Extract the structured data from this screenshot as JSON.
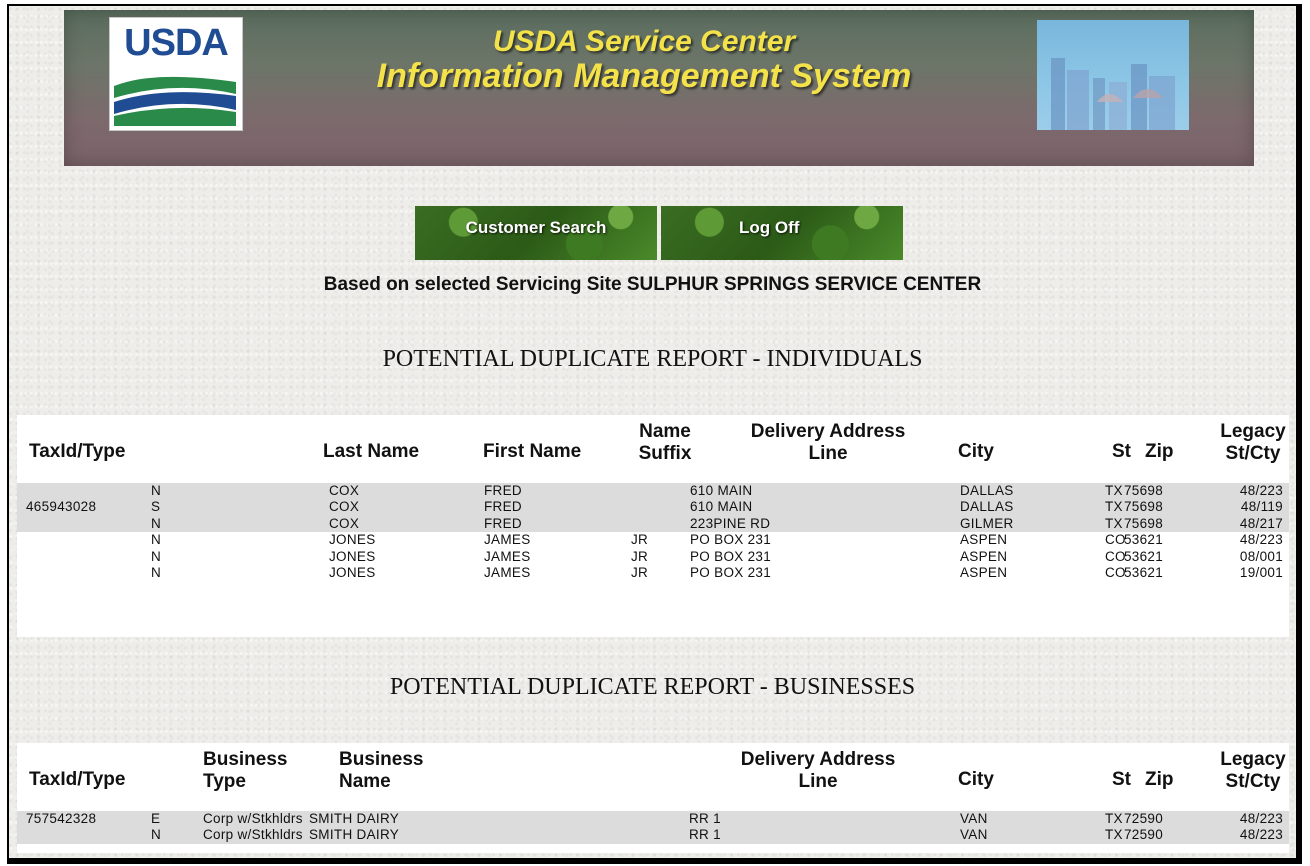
{
  "banner": {
    "logo_text": "USDA",
    "title_line1": "USDA Service Center",
    "title_line2": "Information Management System"
  },
  "nav": {
    "customer_search": "Customer Search",
    "log_off": "Log Off"
  },
  "site_text": "Based on selected Servicing Site SULPHUR SPRINGS SERVICE CENTER",
  "individuals": {
    "title": "POTENTIAL DUPLICATE REPORT - INDIVIDUALS",
    "headers": {
      "taxid": "TaxId/Type",
      "last": "Last Name",
      "first": "First Name",
      "suffix_1": "Name",
      "suffix_2": "Suffix",
      "addr_1": "Delivery Address",
      "addr_2": "Line",
      "city": "City",
      "st": "St",
      "zip": "Zip",
      "legacy_1": "Legacy",
      "legacy_2": "St/Cty"
    },
    "rows": [
      {
        "taxid": "",
        "type": "N",
        "last": "COX",
        "first": "FRED",
        "suffix": "",
        "addr": "610 MAIN",
        "city": "DALLAS",
        "st": "TX",
        "zip": "75698",
        "legacy": "48/223"
      },
      {
        "taxid": "465943028",
        "type": "S",
        "last": "COX",
        "first": "FRED",
        "suffix": "",
        "addr": "610 MAIN",
        "city": "DALLAS",
        "st": "TX",
        "zip": "75698",
        "legacy": "48/119"
      },
      {
        "taxid": "",
        "type": "N",
        "last": "COX",
        "first": "FRED",
        "suffix": "",
        "addr": "223PINE RD",
        "city": "GILMER",
        "st": "TX",
        "zip": "75698",
        "legacy": "48/217"
      },
      {
        "taxid": "",
        "type": "N",
        "last": "JONES",
        "first": "JAMES",
        "suffix": "JR",
        "addr": "PO BOX 231",
        "city": "ASPEN",
        "st": "CO",
        "zip": "53621",
        "legacy": "48/223"
      },
      {
        "taxid": "",
        "type": "N",
        "last": "JONES",
        "first": "JAMES",
        "suffix": "JR",
        "addr": "PO BOX 231",
        "city": "ASPEN",
        "st": "CO",
        "zip": "53621",
        "legacy": "08/001"
      },
      {
        "taxid": "",
        "type": "N",
        "last": "JONES",
        "first": "JAMES",
        "suffix": "JR",
        "addr": "PO BOX 231",
        "city": "ASPEN",
        "st": "CO",
        "zip": "53621",
        "legacy": "19/001"
      }
    ]
  },
  "businesses": {
    "title": "POTENTIAL DUPLICATE REPORT - BUSINESSES",
    "headers": {
      "taxid": "TaxId/Type",
      "btype_1": "Business",
      "btype_2": "Type",
      "bname_1": "Business",
      "bname_2": "Name",
      "addr_1": "Delivery Address",
      "addr_2": "Line",
      "city": "City",
      "st": "St",
      "zip": "Zip",
      "legacy_1": "Legacy",
      "legacy_2": "St/Cty"
    },
    "rows": [
      {
        "taxid": "757542328",
        "type": "E",
        "btype": "Corp w/Stkhldrs",
        "bname": "SMITH DAIRY",
        "addr": "RR 1",
        "city": "VAN",
        "st": "TX",
        "zip": "72590",
        "legacy": "48/223"
      },
      {
        "taxid": "",
        "type": "N",
        "btype": "Corp w/Stkhldrs",
        "bname": "SMITH DAIRY",
        "addr": "RR 1",
        "city": "VAN",
        "st": "TX",
        "zip": "72590",
        "legacy": "48/223"
      }
    ]
  }
}
